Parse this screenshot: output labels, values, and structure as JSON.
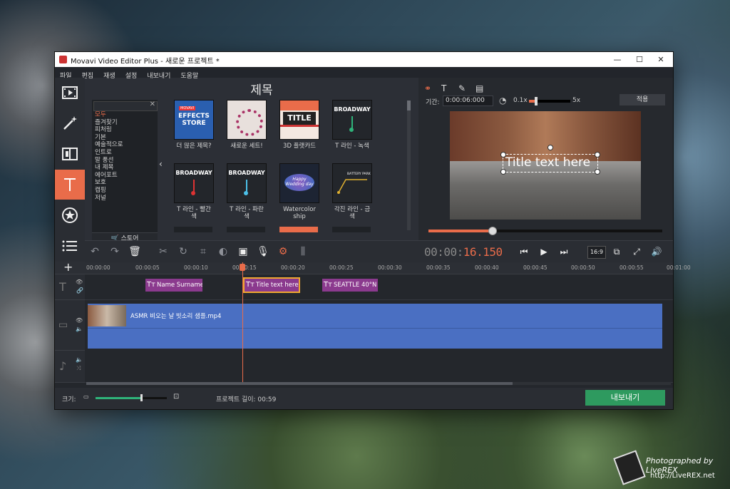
{
  "window": {
    "title": "Movavi Video Editor Plus - 새로운 프로젝트 *"
  },
  "menu": [
    "파일",
    "편집",
    "재생",
    "설정",
    "내보내기",
    "도움말"
  ],
  "gallery": {
    "title": "제목",
    "categories": [
      "모두",
      "즐겨찾기",
      "피처링",
      "기본",
      "예술적으로",
      "인트로",
      "말 풍선",
      "내 제목",
      "에어포트",
      "보호",
      "캡핑",
      "저널"
    ],
    "selected_category": "모두",
    "store_label": "스토어",
    "tiles": [
      {
        "label": "더 많은 제목?",
        "thumb_text": "EFFECTS STORE",
        "thumb_sub": "MOVAVI"
      },
      {
        "label": "새로운 세트!",
        "thumb_text": ""
      },
      {
        "label": "3D 플랫카드",
        "thumb_text": "TITLE"
      },
      {
        "label": "T 라인 - 녹색",
        "thumb_text": "BROADWAY"
      },
      {
        "label": "T 라인 - 빨간 색",
        "thumb_text": "BROADWAY"
      },
      {
        "label": "T 라인 - 파란 색",
        "thumb_text": "BROADWAY"
      },
      {
        "label": "Watercolor ship",
        "thumb_text": "Happy Wedding day"
      },
      {
        "label": "각진 라인 - 금색",
        "thumb_text": "BATTERY PARK"
      }
    ]
  },
  "properties": {
    "duration_label": "기간:",
    "duration_value": "0:00:06:000",
    "speed_min": "0.1x",
    "speed_max": "5x",
    "apply_label": "적용",
    "preview_text": "Title text here",
    "progress": 0.27
  },
  "player": {
    "timecode_dim": "00:00:",
    "timecode_hi": "16.150",
    "aspect": "16:9"
  },
  "timeline": {
    "ruler": [
      "00:00:00",
      "00:00:05",
      "00:00:10",
      "00:00:15",
      "00:00:20",
      "00:00:25",
      "00:00:30",
      "00:00:35",
      "00:00:40",
      "00:00:45",
      "00:00:50",
      "00:00:55",
      "00:01:00"
    ],
    "title_clips": [
      "Name Surname",
      "Title text here",
      "SEATTLE 40°N"
    ],
    "video_clip": "ASMR 비오는 날 빗소리 샘플.mp4"
  },
  "status": {
    "size_label": "크기:",
    "zoom": 0.64,
    "project_length": "프로젝트 길이: 00:59",
    "export_label": "내보내기"
  },
  "watermark": {
    "line1": "Photographed by LiveREX",
    "line2": "http://LiveREX.net"
  }
}
